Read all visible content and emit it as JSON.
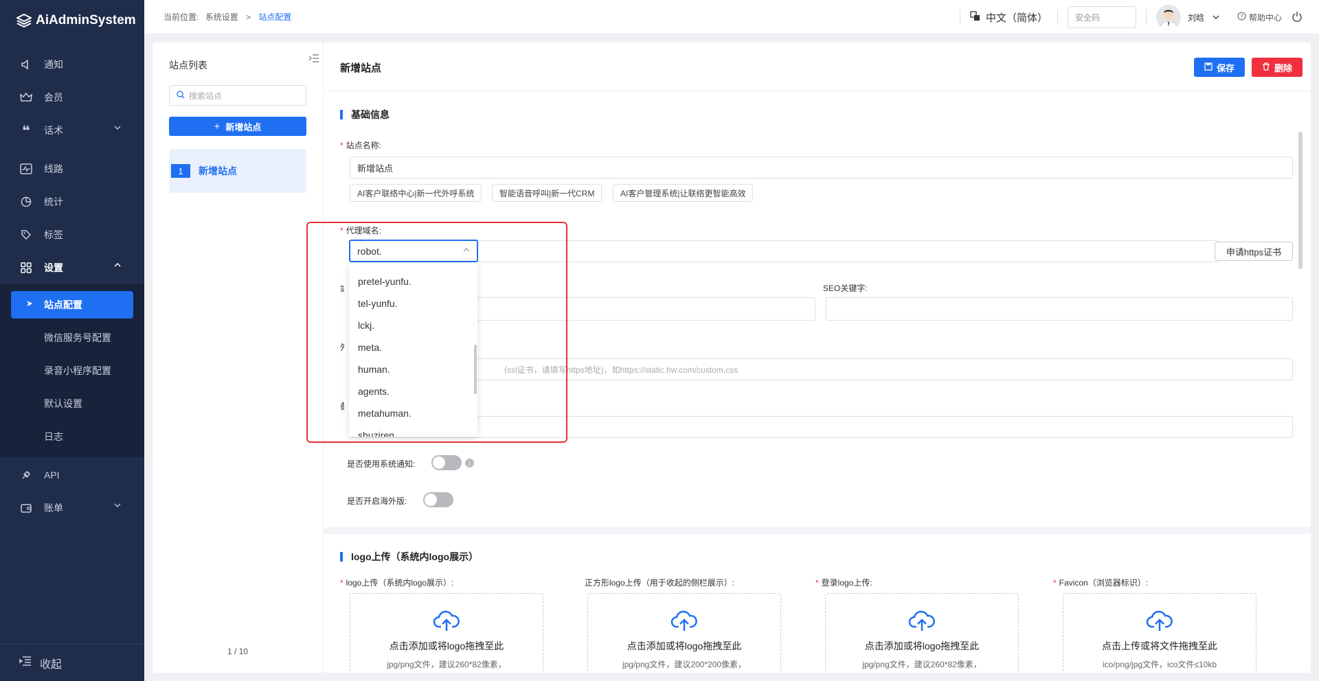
{
  "app": {
    "name": "AiAdminSystem"
  },
  "sidebar": {
    "items": [
      {
        "label": "通知",
        "icon": "speaker-icon"
      },
      {
        "label": "会员",
        "icon": "crown-icon"
      },
      {
        "label": "话术",
        "icon": "quote-icon"
      },
      {
        "label": "线路",
        "icon": "pulse-icon"
      },
      {
        "label": "统计",
        "icon": "pie-icon"
      },
      {
        "label": "标签",
        "icon": "tag-icon"
      },
      {
        "label": "设置",
        "icon": "grid-icon"
      }
    ],
    "sub_items": [
      "站点配置",
      "微信服务号配置",
      "录音小程序配置",
      "默认设置",
      "日志"
    ],
    "bottom_items": [
      {
        "label": "API",
        "icon": "plug-icon"
      },
      {
        "label": "账单",
        "icon": "wallet-icon"
      }
    ],
    "collapse_label": "收起"
  },
  "header": {
    "breadcrumb_prefix": "当前位置:",
    "breadcrumb_1": "系统设置",
    "breadcrumb_sep": ">",
    "breadcrumb_current": "站点配置",
    "language": "中文（简体）",
    "secure_placeholder": "安全码",
    "username": "刘晗",
    "help": "帮助中心"
  },
  "list_panel": {
    "title": "站点列表",
    "search_placeholder": "搜索站点",
    "add_button": "新增站点",
    "items": [
      {
        "index": "1",
        "name": "新增站点"
      }
    ],
    "pagination": "1 / 10"
  },
  "main": {
    "title": "新增站点",
    "save": "保存",
    "delete": "删除",
    "section_basic": "基础信息",
    "site_name_label": "站点名称:",
    "site_name_value": "新增站点",
    "chips": [
      "AI客户联络中心|新一代外呼系统",
      "智能语音呼叫|新一代CRM",
      "AI客户管理系统|让联络更智能高效"
    ],
    "proxy_label": "代理域名:",
    "proxy_select_value": "robot.",
    "https_button": "申请https证书",
    "seo_label": "SEO关键字:",
    "css_placeholder_fragment": "ssl证书，请填写https地址)，如https://static.hw.com/custom.css",
    "notice_label": "是否使用系统通知:",
    "overseas_label": "是否开启海外版:",
    "section_logo": "logo上传（系统内logo展示）",
    "uploads": [
      {
        "label": "logo上传（系统内logo展示）:",
        "required": true,
        "text": "点击添加或将logo拖拽至此",
        "hint": "jpg/png文件，建议260*82像素，"
      },
      {
        "label": "正方形logo上传（用于收起的侧栏展示）:",
        "required": false,
        "text": "点击添加或将logo拖拽至此",
        "hint": "jpg/png文件，建议200*200像素，"
      },
      {
        "label": "登录logo上传:",
        "required": true,
        "text": "点击添加或将logo拖拽至此",
        "hint": "jpg/png文件，建议260*82像素，"
      },
      {
        "label": "Favicon（浏览器标识）:",
        "required": true,
        "text": "点击上传或将文件拖拽至此",
        "hint": "ico/png/jpg文件，ico文件≤10kb"
      }
    ]
  },
  "dropdown": {
    "options": [
      "pretel-yunfu.",
      "tel-yunfu.",
      "lckj.",
      "meta.",
      "human.",
      "agents.",
      "metahuman.",
      "shuziren."
    ]
  },
  "colors": {
    "primary": "#1f6ff2",
    "danger": "#f0303e",
    "sidebar_bg": "#1f2d4a",
    "highlight": "#e63232"
  }
}
